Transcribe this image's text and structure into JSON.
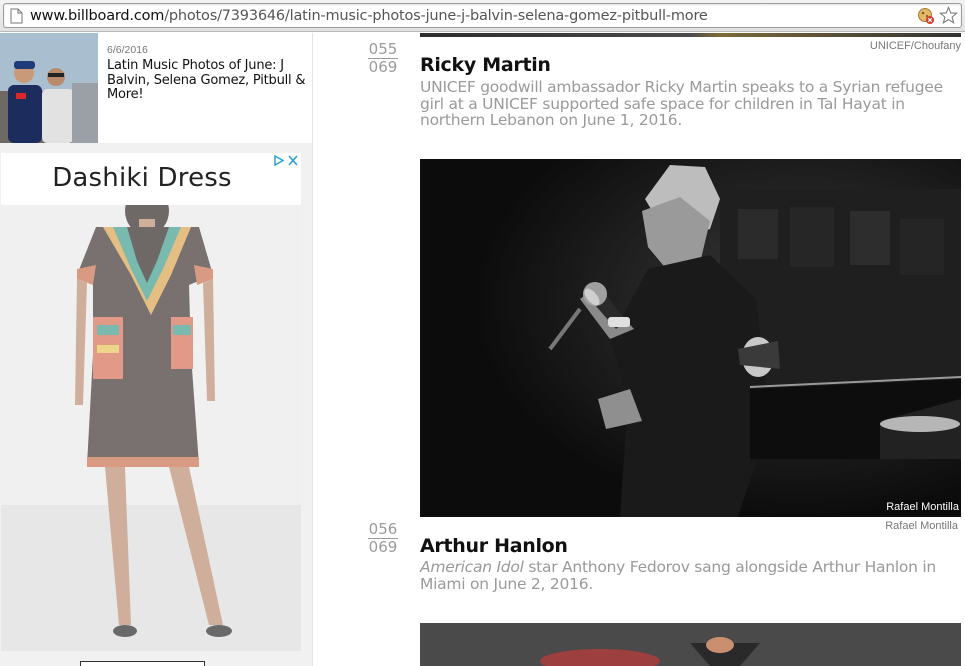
{
  "browser": {
    "url_host": "www.billboard.com",
    "url_path": "/photos/7393646/latin-music-photos-june-j-balvin-selena-gomez-pitbull-more",
    "icons": [
      "page-icon",
      "extension-icon",
      "bookmark-star-icon"
    ]
  },
  "sidebar": {
    "related": {
      "date": "6/6/2016",
      "title": "Latin Music Photos of June: J Balvin, Selena Gomez, Pitbull & More!"
    },
    "ad": {
      "title": "Dashiki Dress",
      "choices_icon": "adchoices-icon"
    }
  },
  "gallery": {
    "items": [
      {
        "credit_top": "UNICEF/Choufany",
        "index": "055",
        "total": "069",
        "name": "Ricky Martin",
        "caption": "UNICEF goodwill ambassador Ricky Martin speaks to a Syrian refugee girl at a UNICEF supported safe space for children in Tal Hayat in northern Lebanon on June 1, 2016."
      },
      {
        "photo_watermark": "Rafael Montilla",
        "credit_top": "Rafael Montilla",
        "index": "056",
        "total": "069",
        "name": "Arthur Hanlon",
        "caption_italic": "American Idol",
        "caption": " star Anthony Fedorov sang alongside Arthur Hanlon in Miami on June 2, 2016."
      }
    ]
  }
}
